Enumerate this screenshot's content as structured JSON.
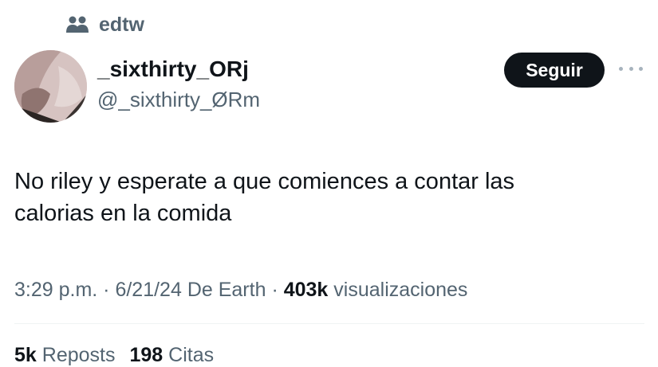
{
  "community": {
    "name": "edtw",
    "icon": "community-icon"
  },
  "author": {
    "display_name": "_sixthirty_ORj",
    "handle": "@_sixthirty_ØRm",
    "avatar": "avatar-photo"
  },
  "actions": {
    "follow_label": "Seguir",
    "more_icon": "more-options-icon"
  },
  "tweet": {
    "text_line1": "No riley y esperate a que comiences a contar las",
    "text_line2": "calorias en la comida"
  },
  "meta": {
    "time": "3:29 p.m.",
    "sep1": " · ",
    "date": "6/21/24",
    "source": "De Earth",
    "sep2": " · ",
    "views_count": "403k",
    "views_label": "visualizaciones"
  },
  "stats": {
    "reposts_count": "5k",
    "reposts_label": "Reposts",
    "quotes_count": "198",
    "quotes_label": "Citas"
  },
  "colors": {
    "text_primary": "#0f1419",
    "text_secondary": "#536471",
    "button_bg": "#0f1419",
    "divider": "#eff3f4"
  }
}
